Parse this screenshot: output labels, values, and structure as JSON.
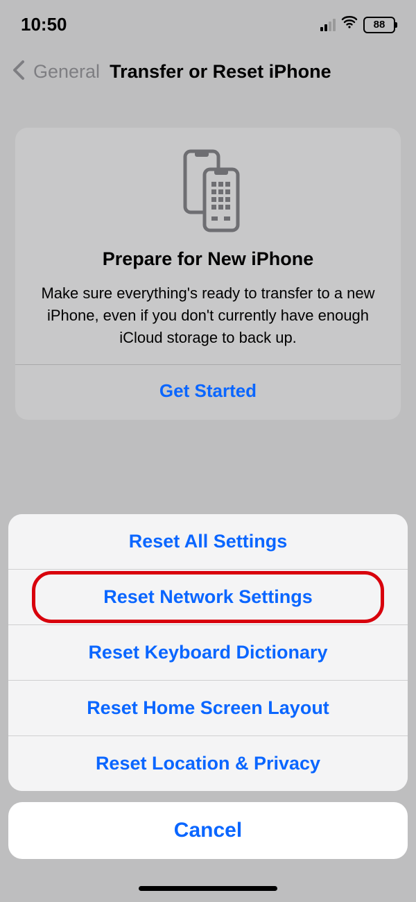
{
  "status": {
    "time": "10:50",
    "battery_pct": "88"
  },
  "nav": {
    "back_label": "General",
    "title": "Transfer or Reset iPhone"
  },
  "card": {
    "title": "Prepare for New iPhone",
    "desc": "Make sure everything's ready to transfer to a new iPhone, even if you don't currently have enough iCloud storage to back up.",
    "action": "Get Started"
  },
  "sheet": {
    "items": [
      "Reset All Settings",
      "Reset Network Settings",
      "Reset Keyboard Dictionary",
      "Reset Home Screen Layout",
      "Reset Location & Privacy"
    ],
    "highlighted_index": 1
  },
  "cancel_label": "Cancel",
  "accent_color": "#0a66ff",
  "highlight_color": "#d8000c"
}
